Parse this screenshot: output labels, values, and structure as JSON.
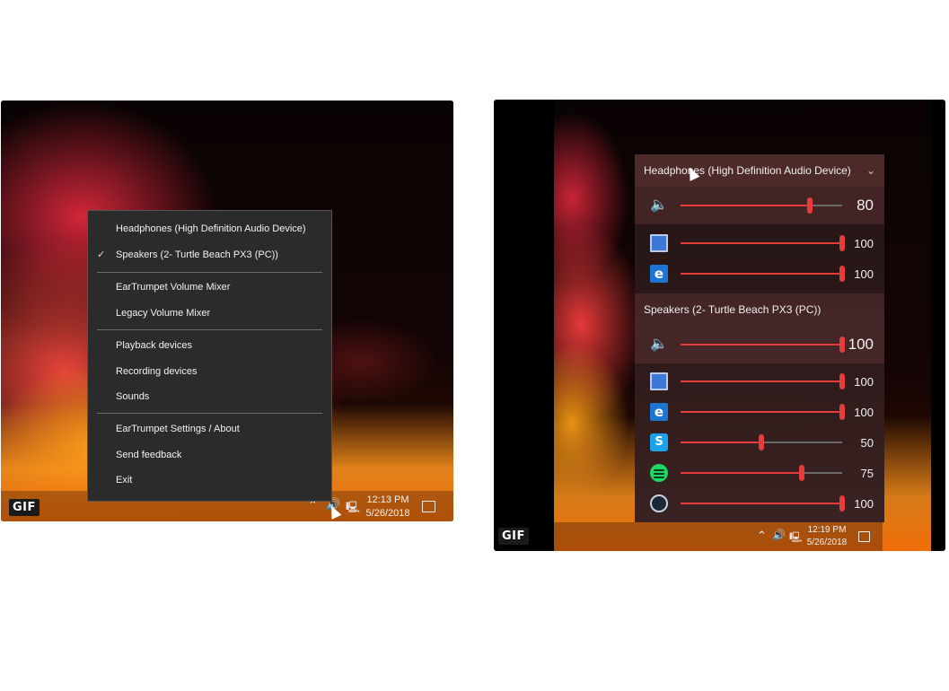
{
  "left": {
    "badge": "GIF",
    "context_menu": {
      "items": [
        {
          "label": "Headphones (High Definition Audio Device)",
          "checked": false
        },
        {
          "label": "Speakers (2- Turtle Beach PX3 (PC))",
          "checked": true
        },
        {
          "label": "EarTrumpet Volume Mixer"
        },
        {
          "label": "Legacy Volume Mixer"
        },
        {
          "label": "Playback devices"
        },
        {
          "label": "Recording devices"
        },
        {
          "label": "Sounds"
        },
        {
          "label": "EarTrumpet Settings  / About"
        },
        {
          "label": "Send feedback"
        },
        {
          "label": "Exit"
        }
      ],
      "check_glyph": "✓"
    },
    "taskbar": {
      "time": "12:13 PM",
      "date": "5/26/2018"
    }
  },
  "right": {
    "badge": "GIF",
    "devices": [
      {
        "name": "Headphones (High Definition Audio Device)",
        "volume": 80,
        "apps": [
          {
            "icon": "system-sounds-icon",
            "volume": 100
          },
          {
            "icon": "edge-icon",
            "volume": 100
          }
        ]
      },
      {
        "name": "Speakers (2- Turtle Beach PX3 (PC))",
        "volume": 100,
        "apps": [
          {
            "icon": "system-sounds-icon",
            "volume": 100
          },
          {
            "icon": "edge-icon",
            "volume": 100
          },
          {
            "icon": "skype-icon",
            "volume": 50
          },
          {
            "icon": "spotify-icon",
            "volume": 75
          },
          {
            "icon": "steam-icon",
            "volume": 100
          }
        ]
      }
    ],
    "taskbar": {
      "time": "12:19 PM",
      "date": "5/26/2018"
    }
  },
  "colors": {
    "accent": "#e63c3c",
    "menu_bg": "#2b2b2b"
  }
}
